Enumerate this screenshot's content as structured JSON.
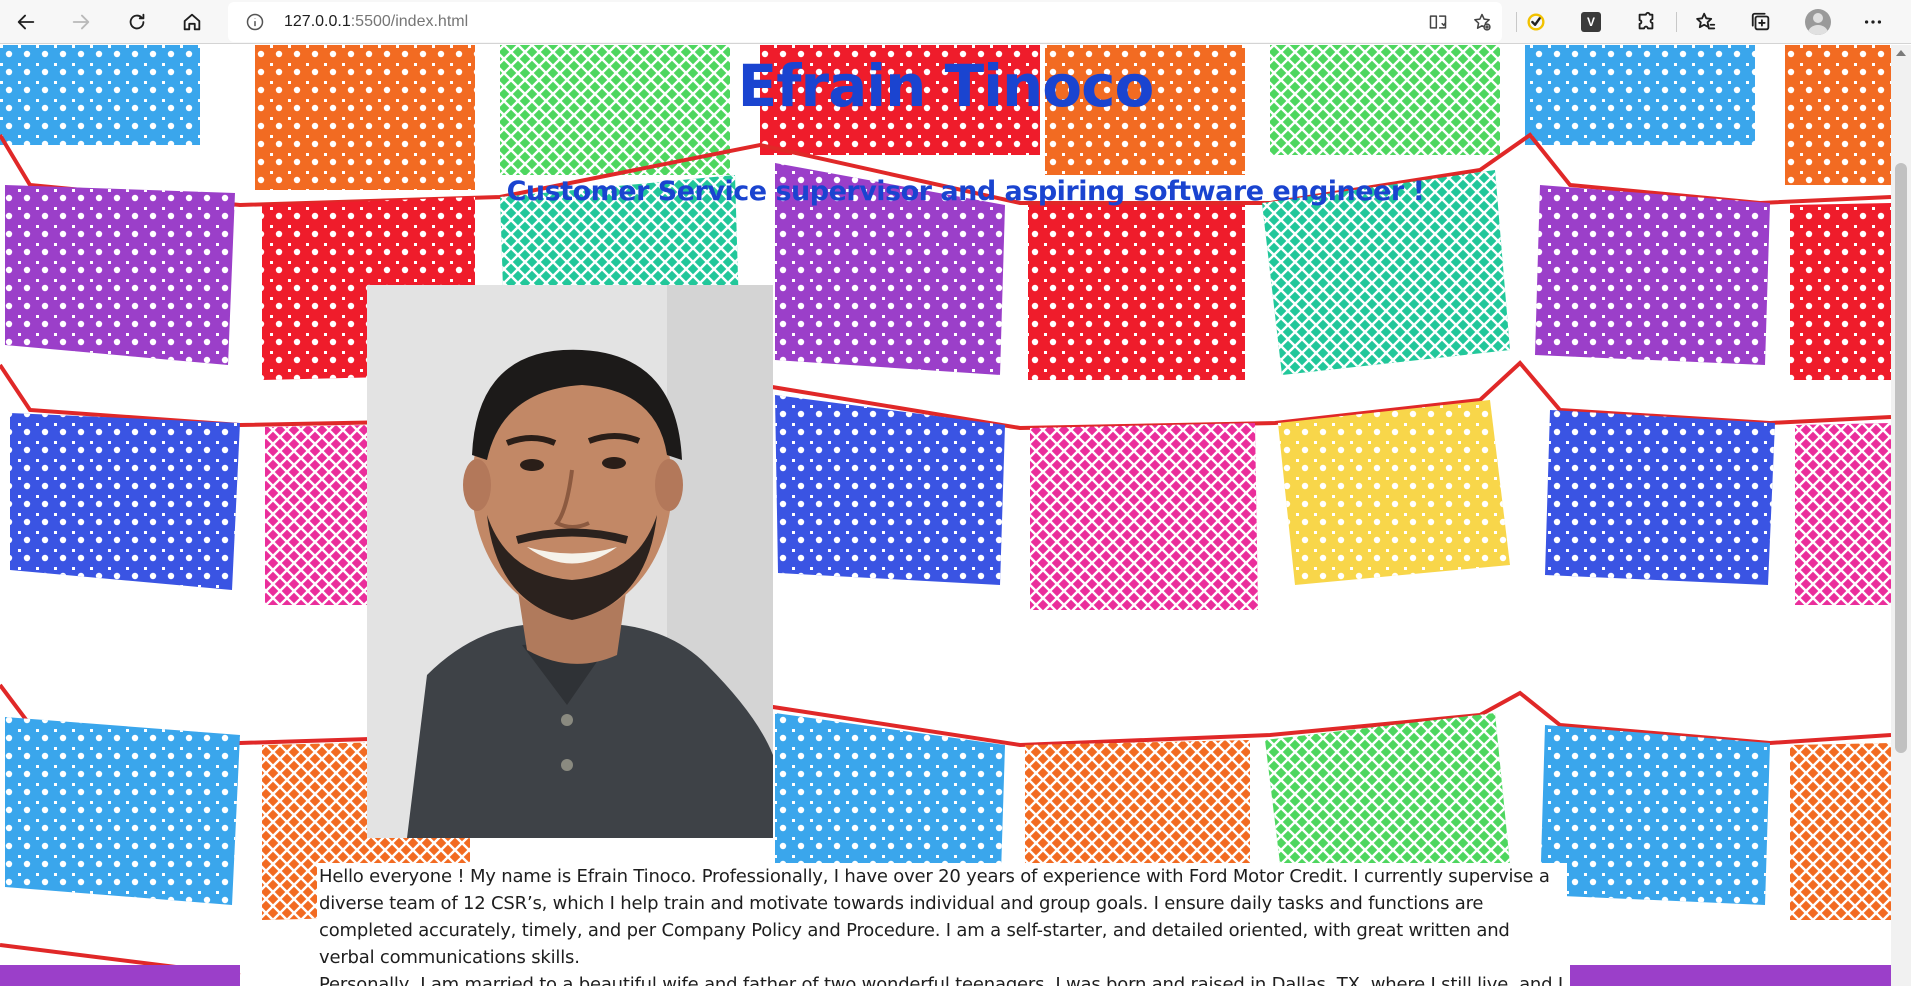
{
  "browser": {
    "url_host": "127.0.0.1",
    "url_path": ":5500/index.html",
    "icons": {
      "back": "back-arrow-icon",
      "forward": "forward-arrow-icon",
      "reload": "reload-icon",
      "home": "home-icon",
      "site_info": "info-icon",
      "reader": "immersive-reader-icon",
      "add_favorite": "add-favorite-icon",
      "extension_check": "checkmark-extension-icon",
      "extension_v": "V",
      "extensions": "puzzle-icon",
      "favorites": "favorites-icon",
      "collections": "collections-icon",
      "profile": "profile-icon",
      "menu": "more-icon"
    }
  },
  "page": {
    "title": "Efrain Tinoco",
    "subtitle": "Customer Service supervisor and aspiring software engineer !",
    "bio_paragraph_1": "Hello everyone ! My name is Efrain Tinoco. Professionally, I have over 20 years of experience with Ford Motor Credit. I currently supervise a diverse team of 12 CSR’s, which I help train and motivate towards individual and group goals. I ensure daily tasks and functions are completed accurately, timely, and per Company Policy and Procedure. I am a self-starter, and detailed oriented, with great written and verbal communications skills.",
    "bio_paragraph_2": "Personally, I am married to a beautiful wife and father of two wonderful teenagers. I was born and raised in Dallas, TX, where I still live, and I"
  },
  "colors": {
    "heading": "#1a44d0",
    "banner_palette": [
      "#3aa6ec",
      "#f26b22",
      "#4ed65f",
      "#9b3fc9",
      "#ef1c2b",
      "#22c79a",
      "#3a54e3",
      "#ea2e9b",
      "#f8d64a"
    ]
  }
}
